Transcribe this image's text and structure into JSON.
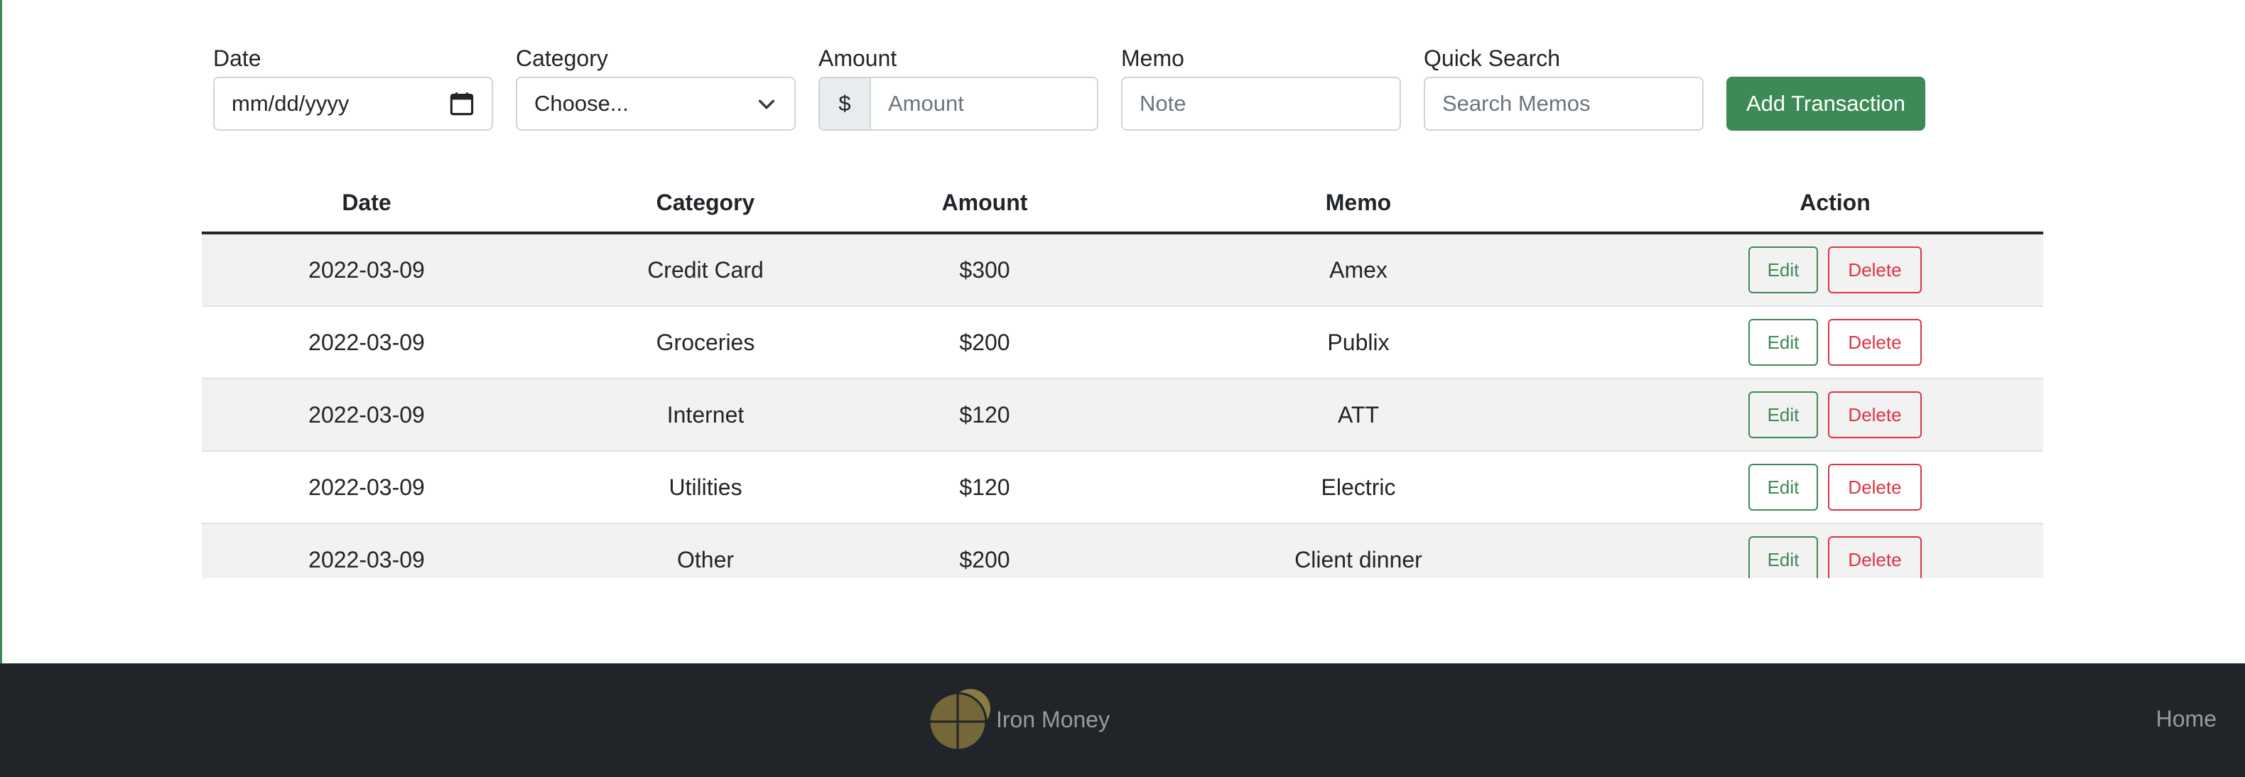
{
  "form": {
    "date": {
      "label": "Date",
      "value": "mm/dd/yyyy"
    },
    "category": {
      "label": "Category",
      "value": "Choose..."
    },
    "amount": {
      "label": "Amount",
      "prefix": "$",
      "placeholder": "Amount"
    },
    "memo": {
      "label": "Memo",
      "placeholder": "Note"
    },
    "quick_search": {
      "label": "Quick Search",
      "placeholder": "Search Memos"
    },
    "add_button": "Add Transaction"
  },
  "table": {
    "headers": {
      "date": "Date",
      "category": "Category",
      "amount": "Amount",
      "memo": "Memo",
      "action": "Action"
    },
    "rows": [
      {
        "date": "2022-03-09",
        "category": "Credit Card",
        "amount": "$300",
        "memo": "Amex",
        "edit": "Edit",
        "delete": "Delete"
      },
      {
        "date": "2022-03-09",
        "category": "Groceries",
        "amount": "$200",
        "memo": "Publix",
        "edit": "Edit",
        "delete": "Delete"
      },
      {
        "date": "2022-03-09",
        "category": "Internet",
        "amount": "$120",
        "memo": "ATT",
        "edit": "Edit",
        "delete": "Delete"
      },
      {
        "date": "2022-03-09",
        "category": "Utilities",
        "amount": "$120",
        "memo": "Electric",
        "edit": "Edit",
        "delete": "Delete"
      },
      {
        "date": "2022-03-09",
        "category": "Other",
        "amount": "$200",
        "memo": "Client dinner",
        "edit": "Edit",
        "delete": "Delete"
      }
    ]
  },
  "footer": {
    "brand": "Iron Money",
    "home": "Home"
  },
  "colors": {
    "primary_green": "#3c8a55",
    "danger_red": "#dc3545",
    "footer_bg": "#212529",
    "logo_gold": "#8a7a45"
  }
}
